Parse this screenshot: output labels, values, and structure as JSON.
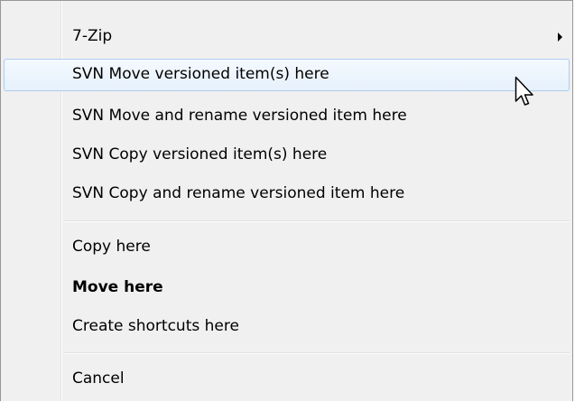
{
  "menu": {
    "items": [
      {
        "label": "7-Zip"
      },
      {
        "label": "SVN Move versioned item(s) here"
      },
      {
        "label": "SVN Move and rename versioned item here"
      },
      {
        "label": "SVN Copy versioned item(s) here"
      },
      {
        "label": "SVN Copy and rename versioned item here"
      },
      {
        "label": "Copy here"
      },
      {
        "label": "Move here"
      },
      {
        "label": "Create shortcuts here"
      },
      {
        "label": "Cancel"
      }
    ],
    "submenu_icon": "chevron-right-icon",
    "cursor_icon": "mouse-pointer-icon",
    "highlight_color": "#e6f1fc",
    "highlight_border": "#aeccf1"
  }
}
